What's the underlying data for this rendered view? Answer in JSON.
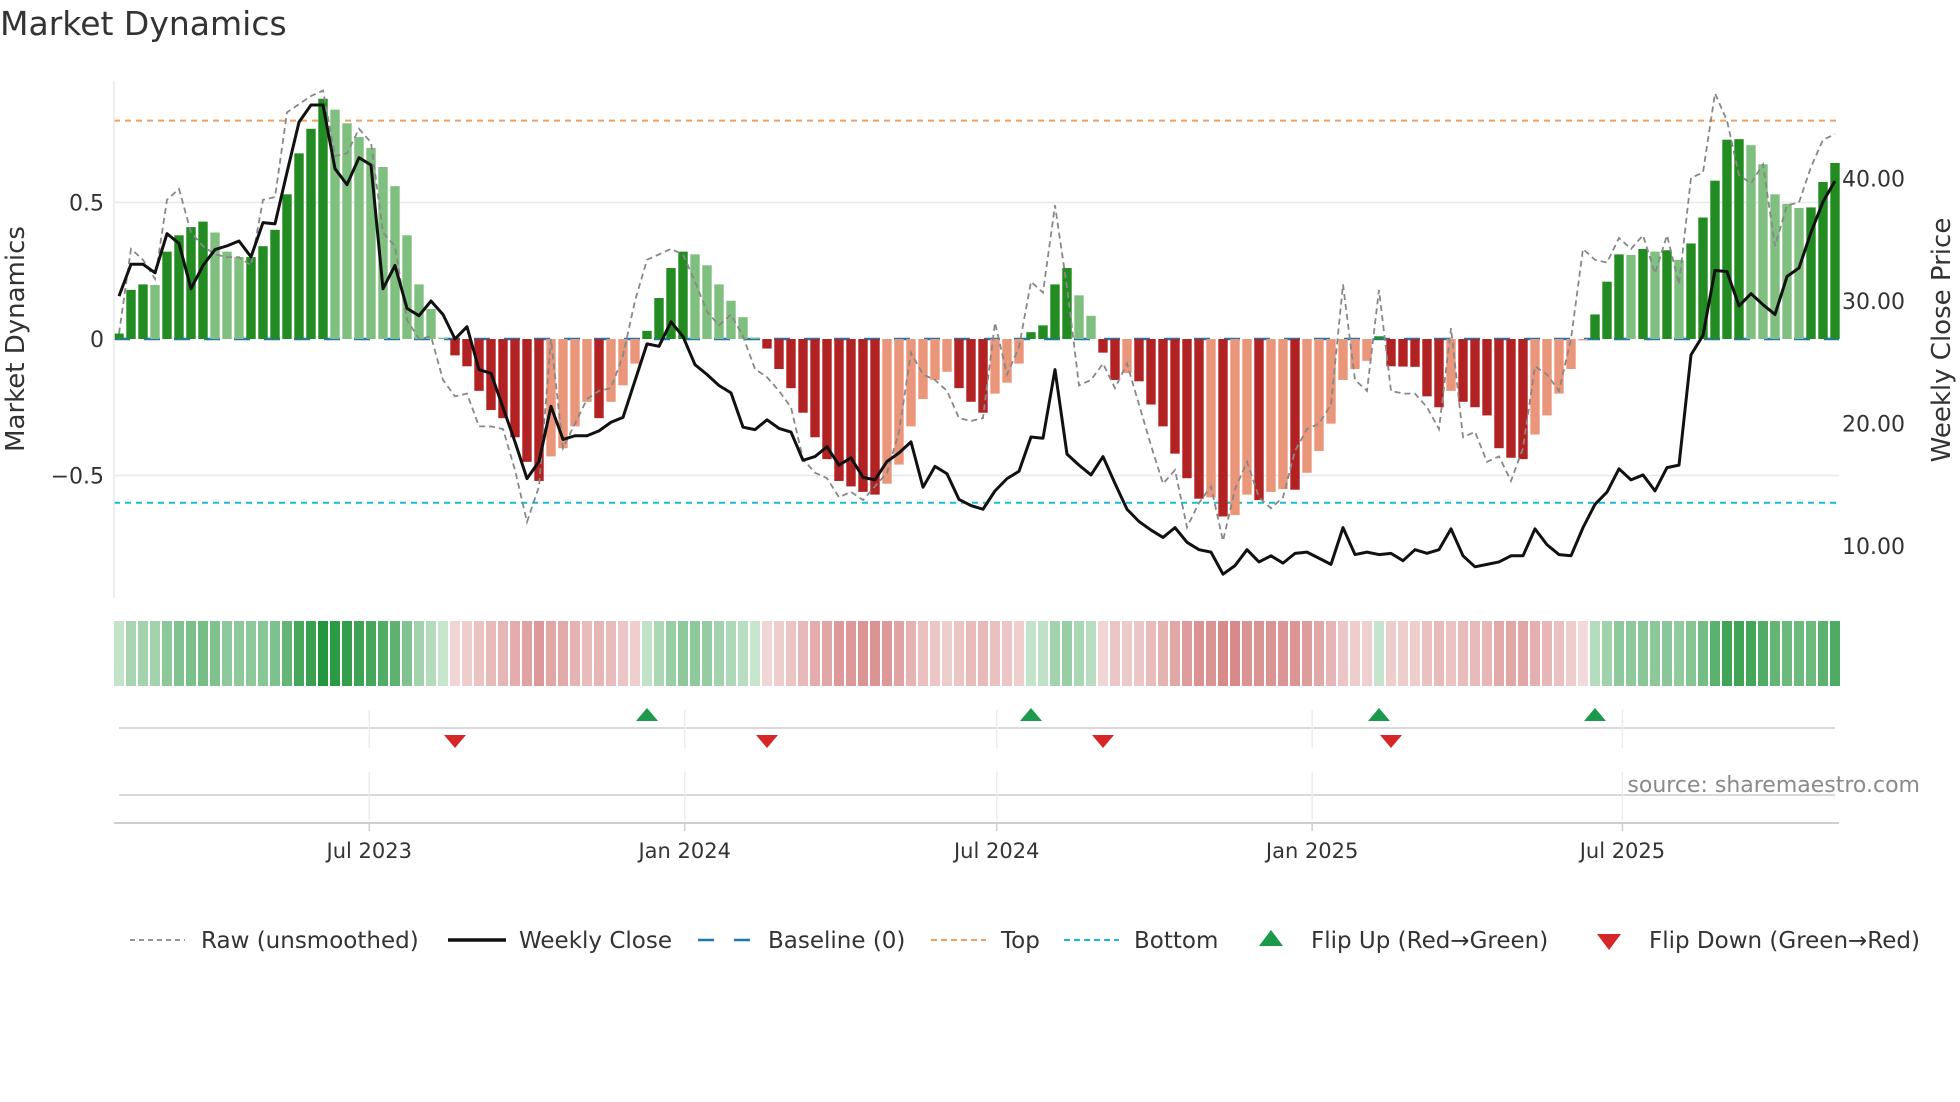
{
  "title": "Market Dynamics",
  "source": "source: sharemaestro.com",
  "colors": {
    "up_strong": "#228b22",
    "up_weak": "#7fbf7f",
    "down_strong": "#b22222",
    "down_weak": "#e9967a",
    "raw": "#888888",
    "close": "#111111",
    "baseline": "#1f77b4",
    "top": "#f0a060",
    "bottom": "#17becf",
    "flip_up": "#1a9a4a",
    "flip_down": "#d62728"
  },
  "chart_data": {
    "type": "bar",
    "title": "Market Dynamics",
    "ylabel": "Market Dynamics",
    "y2label": "Weekly Close Price",
    "ylim": [
      -0.97,
      0.95
    ],
    "y2lim": [
      3.6,
      49.6
    ],
    "yticks": [
      {
        "v": 0.5,
        "label": "0.5"
      },
      {
        "v": 0,
        "label": "0"
      },
      {
        "v": -0.5,
        "label": "−0.5"
      }
    ],
    "y2ticks": [
      {
        "v": 40,
        "label": "40.00"
      },
      {
        "v": 30,
        "label": "30.00"
      },
      {
        "v": 20,
        "label": "20.00"
      },
      {
        "v": 10,
        "label": "10.00"
      }
    ],
    "x_start": "2023-02-05",
    "x_freq": "weekly",
    "xticks": [
      {
        "date": "2023-07-01",
        "label": "Jul 2023"
      },
      {
        "date": "2024-01-01",
        "label": "Jan 2024"
      },
      {
        "date": "2024-07-01",
        "label": "Jul 2024"
      },
      {
        "date": "2025-01-01",
        "label": "Jan 2025"
      },
      {
        "date": "2025-07-01",
        "label": "Jul 2025"
      }
    ],
    "top_level": 0.8,
    "bottom_level": -0.6,
    "baseline": 0,
    "dynamics": [
      0.02,
      0.18,
      0.2,
      0.198,
      0.32,
      0.38,
      0.41,
      0.43,
      0.39,
      0.32,
      0.3,
      0.3,
      0.34,
      0.4,
      0.53,
      0.68,
      0.77,
      0.88,
      0.84,
      0.79,
      0.74,
      0.7,
      0.63,
      0.56,
      0.38,
      0.2,
      0.11,
      0.005,
      -0.06,
      -0.1,
      -0.19,
      -0.26,
      -0.29,
      -0.36,
      -0.45,
      -0.52,
      -0.43,
      -0.4,
      -0.32,
      -0.23,
      -0.29,
      -0.23,
      -0.17,
      -0.09,
      0.03,
      0.15,
      0.26,
      0.32,
      0.31,
      0.27,
      0.2,
      0.14,
      0.08,
      0.005,
      -0.035,
      -0.11,
      -0.18,
      -0.27,
      -0.36,
      -0.44,
      -0.52,
      -0.54,
      -0.56,
      -0.57,
      -0.53,
      -0.46,
      -0.32,
      -0.22,
      -0.15,
      -0.12,
      -0.18,
      -0.23,
      -0.27,
      -0.2,
      -0.16,
      -0.09,
      0.025,
      0.05,
      0.2,
      0.26,
      0.16,
      0.085,
      -0.05,
      -0.15,
      -0.125,
      -0.155,
      -0.24,
      -0.32,
      -0.42,
      -0.51,
      -0.585,
      -0.58,
      -0.65,
      -0.645,
      -0.57,
      -0.59,
      -0.56,
      -0.55,
      -0.552,
      -0.49,
      -0.41,
      -0.31,
      -0.15,
      -0.11,
      -0.08,
      0.01,
      -0.1,
      -0.101,
      -0.102,
      -0.21,
      -0.25,
      -0.19,
      -0.23,
      -0.25,
      -0.28,
      -0.4,
      -0.435,
      -0.44,
      -0.35,
      -0.28,
      -0.2,
      -0.11,
      -0.005,
      0.09,
      0.21,
      0.31,
      0.308,
      0.33,
      0.32,
      0.325,
      0.29,
      0.35,
      0.445,
      0.58,
      0.73,
      0.732,
      0.71,
      0.64,
      0.53,
      0.495,
      0.48,
      0.482,
      0.575,
      0.645
    ],
    "raw": [
      0.02,
      0.33,
      0.29,
      0.22,
      0.51,
      0.55,
      0.39,
      0.34,
      0.31,
      0.3,
      0.3,
      0.27,
      0.51,
      0.52,
      0.83,
      0.86,
      0.89,
      0.91,
      0.67,
      0.68,
      0.77,
      0.72,
      0.39,
      0.34,
      0.07,
      0.0,
      0.01,
      -0.15,
      -0.21,
      -0.2,
      -0.32,
      -0.32,
      -0.33,
      -0.48,
      -0.67,
      -0.54,
      0.0,
      -0.4,
      -0.31,
      -0.22,
      -0.19,
      -0.18,
      -0.06,
      0.14,
      0.29,
      0.31,
      0.33,
      0.31,
      0.21,
      0.1,
      0.05,
      0.09,
      0.01,
      -0.11,
      -0.14,
      -0.19,
      -0.25,
      -0.44,
      -0.49,
      -0.51,
      -0.58,
      -0.56,
      -0.59,
      -0.54,
      -0.49,
      -0.34,
      -0.05,
      -0.13,
      -0.15,
      -0.19,
      -0.29,
      -0.3,
      -0.29,
      0.06,
      -0.13,
      -0.03,
      0.21,
      0.17,
      0.49,
      0.19,
      -0.17,
      -0.15,
      -0.09,
      -0.18,
      -0.09,
      -0.24,
      -0.39,
      -0.53,
      -0.48,
      -0.69,
      -0.6,
      -0.54,
      -0.74,
      -0.55,
      -0.45,
      -0.58,
      -0.62,
      -0.58,
      -0.41,
      -0.33,
      -0.31,
      -0.24,
      0.2,
      -0.15,
      -0.19,
      0.18,
      -0.19,
      -0.2,
      -0.2,
      -0.25,
      -0.33,
      0.04,
      -0.36,
      -0.34,
      -0.45,
      -0.43,
      -0.52,
      -0.4,
      -0.1,
      -0.13,
      -0.19,
      0.0,
      0.33,
      0.29,
      0.28,
      0.37,
      0.33,
      0.38,
      0.24,
      0.38,
      0.2,
      0.59,
      0.61,
      0.9,
      0.8,
      0.6,
      0.57,
      0.64,
      0.34,
      0.49,
      0.5,
      0.63,
      0.73,
      0.75
    ],
    "close": [
      30.4,
      33.0,
      33.0,
      32.3,
      35.5,
      34.7,
      31.0,
      32.9,
      34.2,
      34.5,
      34.9,
      33.6,
      36.4,
      36.3,
      40.5,
      44.6,
      46.0,
      46.0,
      40.8,
      39.5,
      41.7,
      41.1,
      31.0,
      32.9,
      29.4,
      28.8,
      30.0,
      28.9,
      26.9,
      27.9,
      24.4,
      24.1,
      21.3,
      18.5,
      15.5,
      16.9,
      21.4,
      18.7,
      19.0,
      19.0,
      19.4,
      20.1,
      20.5,
      23.5,
      26.5,
      26.3,
      28.3,
      27.1,
      24.8,
      24.0,
      23.1,
      22.5,
      19.7,
      19.5,
      20.3,
      19.6,
      19.3,
      17.0,
      17.3,
      18.1,
      16.6,
      17.2,
      15.6,
      15.4,
      16.9,
      17.6,
      18.5,
      14.8,
      16.5,
      15.9,
      13.8,
      13.3,
      13.0,
      14.5,
      15.5,
      16.1,
      18.9,
      18.8,
      24.4,
      17.5,
      16.6,
      15.8,
      17.3,
      15.1,
      13.0,
      12.0,
      11.3,
      10.7,
      11.5,
      10.3,
      9.7,
      9.5,
      7.7,
      8.4,
      9.7,
      8.7,
      9.2,
      8.6,
      9.4,
      9.5,
      9.0,
      8.5,
      11.5,
      9.3,
      9.5,
      9.3,
      9.4,
      8.8,
      9.7,
      9.4,
      9.7,
      11.4,
      9.2,
      8.3,
      8.5,
      8.7,
      9.2,
      9.2,
      11.4,
      10.1,
      9.3,
      9.2,
      11.5,
      13.4,
      14.4,
      16.3,
      15.4,
      15.8,
      14.5,
      16.4,
      16.6,
      25.6,
      27.2,
      32.5,
      32.4,
      29.6,
      30.6,
      29.7,
      28.9,
      32.0,
      32.7,
      35.6,
      38.1,
      39.8
    ]
  },
  "legend": [
    {
      "key": "raw",
      "label": "Raw (unsmoothed)"
    },
    {
      "key": "close",
      "label": "Weekly Close"
    },
    {
      "key": "baseline",
      "label": "Baseline (0)"
    },
    {
      "key": "top",
      "label": "Top"
    },
    {
      "key": "bottom",
      "label": "Bottom"
    },
    {
      "key": "flip_up",
      "label": "Flip Up (Red→Green)"
    },
    {
      "key": "flip_down",
      "label": "Flip Down (Green→Red)"
    }
  ]
}
